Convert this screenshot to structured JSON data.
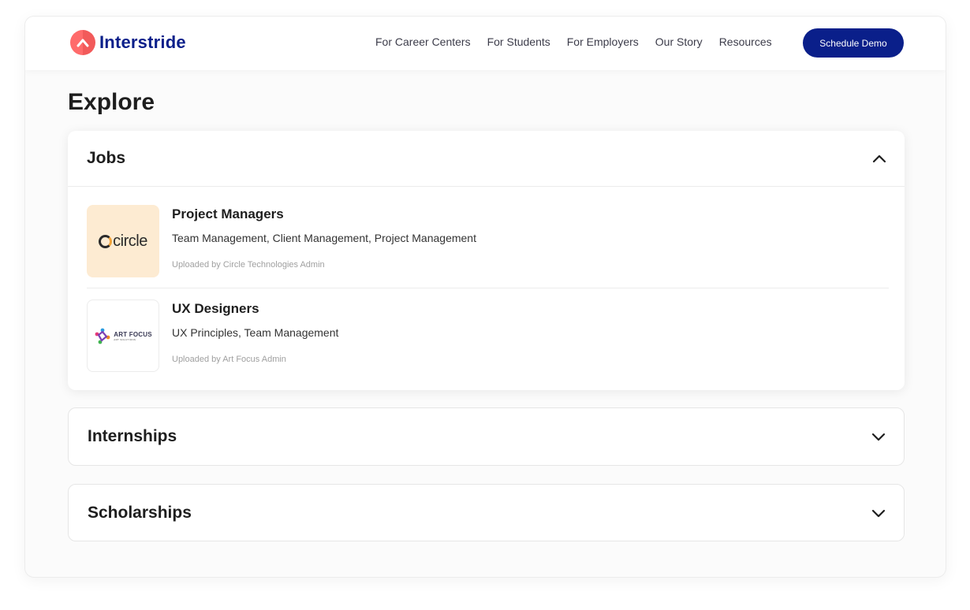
{
  "header": {
    "brand": "Interstride",
    "brand_color": "#0a1f8a",
    "logo_color": "#ff6b6b",
    "nav": [
      {
        "label": "For Career Centers"
      },
      {
        "label": "For Students"
      },
      {
        "label": "For Employers"
      },
      {
        "label": "Our Story"
      },
      {
        "label": "Resources"
      }
    ],
    "cta_label": "Schedule Demo"
  },
  "page": {
    "title": "Explore"
  },
  "sections": [
    {
      "title": "Jobs",
      "expanded": true,
      "toggle_icon": "chevron-up-icon",
      "items": [
        {
          "logo": "Circle",
          "logo_text": "circle",
          "title": "Project Managers",
          "skills": "Team Management, Client Management, Project Management",
          "meta": "Uploaded by Circle Technologies Admin"
        },
        {
          "logo": "Art Focus",
          "logo_text": "ART FOCUS",
          "logo_subtext": "ART SOLUTIONS",
          "title": "UX Designers",
          "skills": "UX Principles, Team Management",
          "meta": "Uploaded by Art Focus Admin"
        }
      ]
    },
    {
      "title": "Internships",
      "expanded": false,
      "toggle_icon": "chevron-down-icon"
    },
    {
      "title": "Scholarships",
      "expanded": false,
      "toggle_icon": "chevron-down-icon"
    }
  ]
}
